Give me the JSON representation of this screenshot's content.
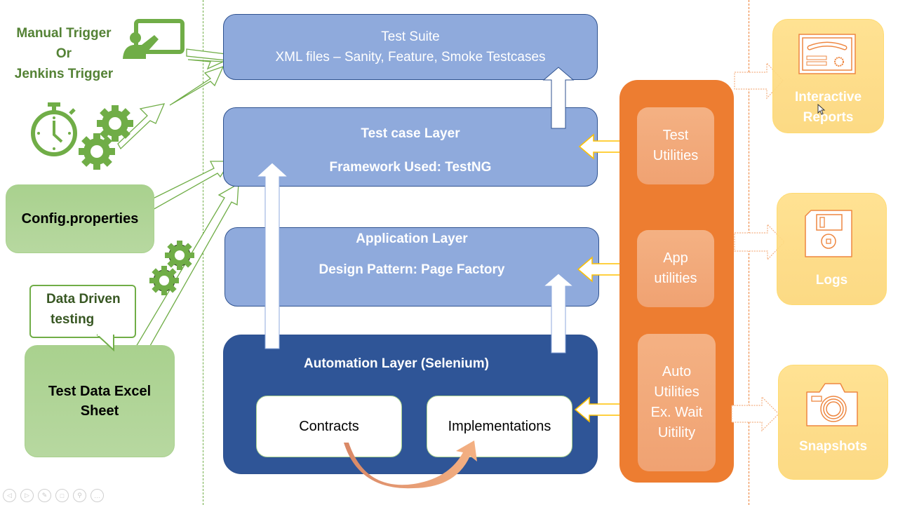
{
  "left_inputs": {
    "trigger_lines": [
      "Manual Trigger",
      "Or",
      "Jenkins Trigger"
    ],
    "config_label": "Config.properties",
    "callout_lines": [
      "Data Driven",
      "testing"
    ],
    "excel_lines": [
      "Test Data Excel",
      "Sheet"
    ]
  },
  "layers": {
    "test_suite": {
      "title": "Test Suite",
      "subtitle": "XML files – Sanity, Feature, Smoke Testcases"
    },
    "test_case": {
      "title": "Test case Layer",
      "subtitle": "Framework Used: TestNG"
    },
    "application": {
      "title": "Application Layer",
      "subtitle": "Design Pattern: Page Factory"
    },
    "automation": {
      "title": "Automation Layer (Selenium)",
      "contracts": "Contracts",
      "implementations": "Implementations"
    }
  },
  "utilities": [
    {
      "lines": [
        "Test",
        "Utilities"
      ]
    },
    {
      "lines": [
        "App",
        "utilities"
      ]
    },
    {
      "lines": [
        "Auto",
        "Utilities",
        "Ex. Wait",
        "Uitility"
      ]
    }
  ],
  "outputs": [
    {
      "lines": [
        "Interactive",
        "Reports"
      ],
      "icon": "certificate-icon"
    },
    {
      "lines": [
        "Logs"
      ],
      "icon": "floppy-disk-icon"
    },
    {
      "lines": [
        "Snapshots"
      ],
      "icon": "camera-icon"
    }
  ],
  "colors": {
    "green": "#70ad47",
    "dark_green": "#548235",
    "layer_blue": "#8faadc",
    "automation_blue": "#2f5597",
    "orange": "#ed7d31",
    "light_orange": "#f4b183",
    "gold": "#ffd966"
  }
}
